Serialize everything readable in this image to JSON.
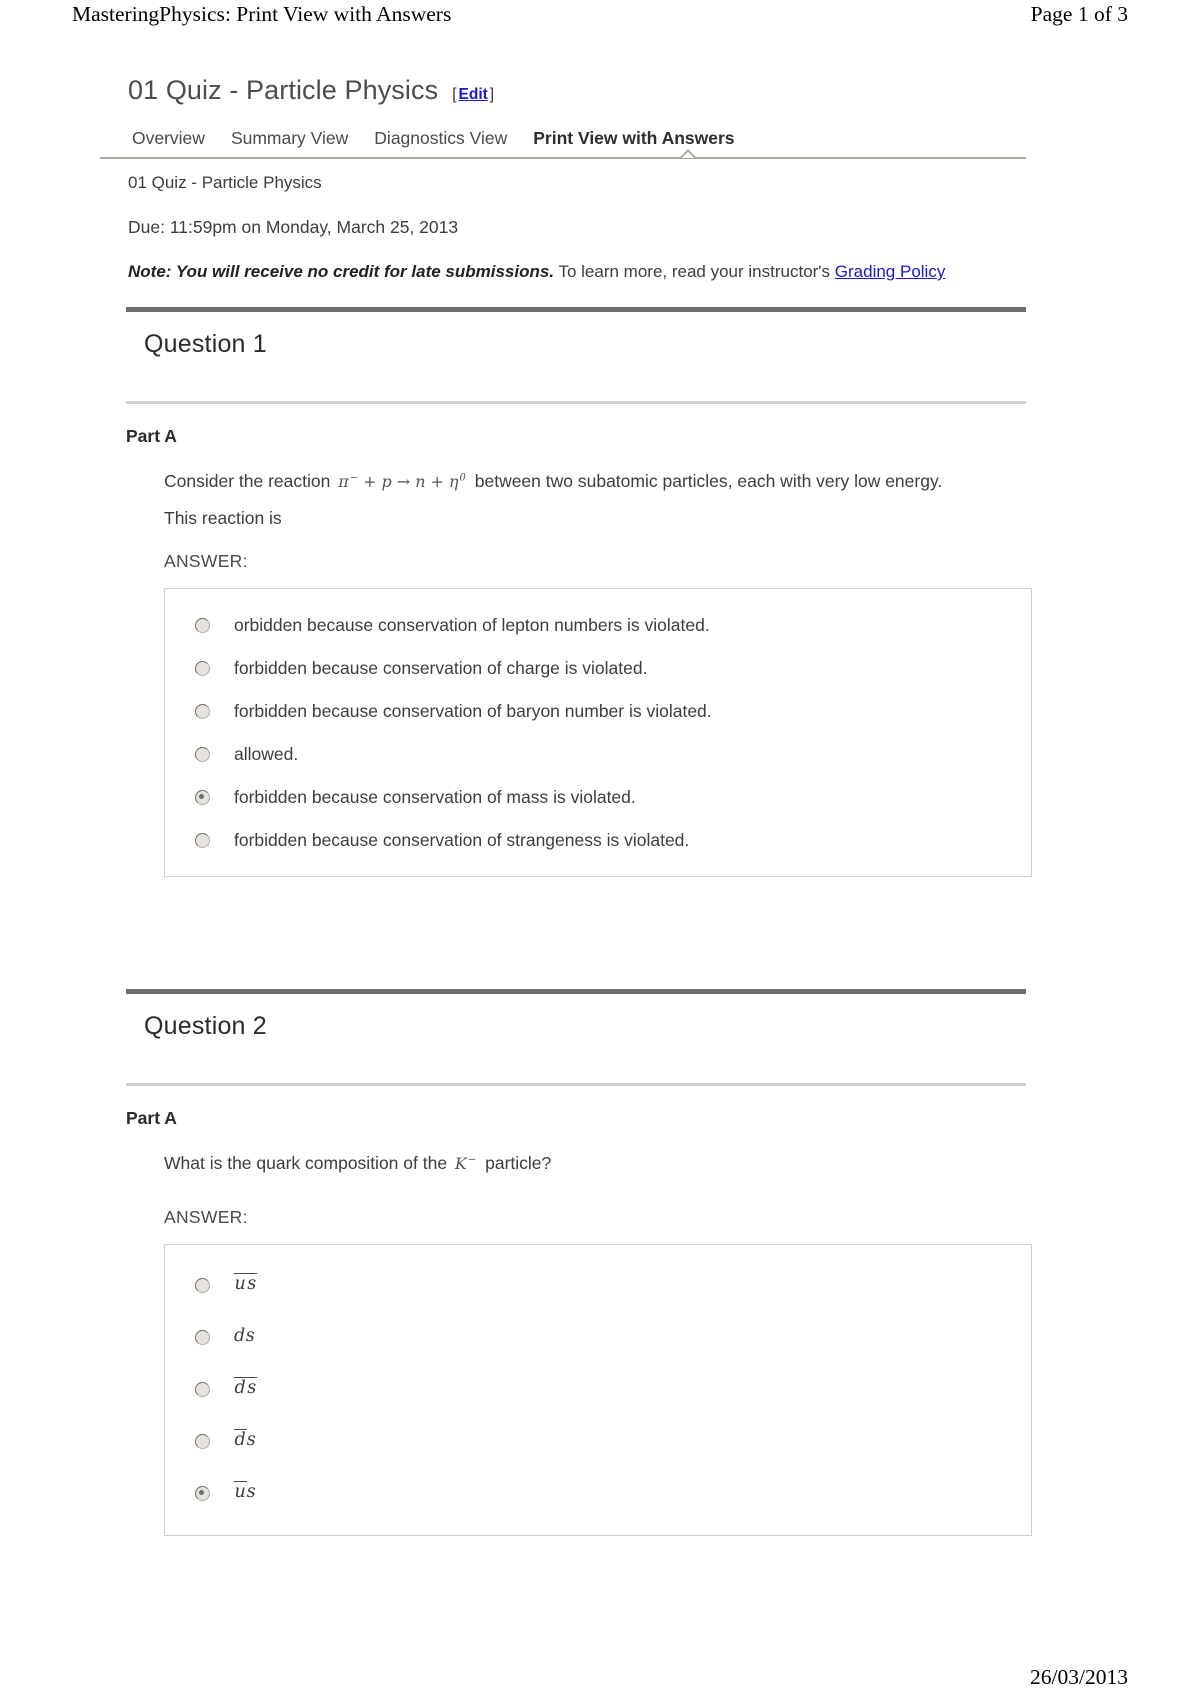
{
  "header": {
    "left_title": "MasteringPhysics: Print View with Answers",
    "page_indicator": "Page 1 of 3"
  },
  "assignment": {
    "title": "01 Quiz - Particle Physics",
    "edit_bracket_open": "[",
    "edit_label": "Edit",
    "edit_bracket_close": "]",
    "subtitle": "01 Quiz - Particle Physics",
    "due_line": "Due: 11:59pm on Monday, March 25, 2013",
    "note_strong": "Note: You will receive no credit for late submissions.",
    "note_rest": " To learn more, read your instructor's ",
    "note_link": "Grading Policy"
  },
  "tabs": [
    {
      "label": "Overview",
      "active": false
    },
    {
      "label": "Summary View",
      "active": false
    },
    {
      "label": "Diagnostics View",
      "active": false
    },
    {
      "label": "Print View with Answers",
      "active": true
    }
  ],
  "questions": [
    {
      "title": "Question 1",
      "part_label": "Part A",
      "prompt_prefix": "Consider the reaction ",
      "equation": {
        "term1": "π",
        "term1_sup": "−",
        "op1": "+",
        "term2": "p",
        "arrow": "→",
        "op2": "+",
        "term3": "n",
        "term4": "η",
        "term4_sup": "0"
      },
      "prompt_suffix": " between two subatomic particles, each with very low energy.",
      "prompt_line2": "This reaction is",
      "answer_label": "ANSWER:",
      "choices": [
        {
          "text": "orbidden because conservation of lepton numbers is violated.",
          "selected": false
        },
        {
          "text": "forbidden because conservation of charge is violated.",
          "selected": false
        },
        {
          "text": "forbidden because conservation of baryon number is violated.",
          "selected": false
        },
        {
          "text": "allowed.",
          "selected": false
        },
        {
          "text": "forbidden because conservation of mass is violated.",
          "selected": true
        },
        {
          "text": "forbidden because conservation of strangeness is violated.",
          "selected": false
        }
      ]
    },
    {
      "title": "Question 2",
      "part_label": "Part A",
      "prompt_prefix": "What is the quark composition of the ",
      "particle": {
        "symbol": "K",
        "sup": "−"
      },
      "prompt_suffix": " particle?",
      "answer_label": "ANSWER:",
      "choices": [
        {
          "quarks": [
            {
              "letter": "u",
              "bar": true
            },
            {
              "letter": "s",
              "bar": true
            }
          ],
          "selected": false
        },
        {
          "quarks": [
            {
              "letter": "d",
              "bar": false
            },
            {
              "letter": "s",
              "bar": false
            }
          ],
          "selected": false
        },
        {
          "quarks": [
            {
              "letter": "d",
              "bar": true
            },
            {
              "letter": "s",
              "bar": true
            }
          ],
          "selected": false
        },
        {
          "quarks": [
            {
              "letter": "d",
              "bar": true
            },
            {
              "letter": "s",
              "bar": false
            }
          ],
          "selected": false
        },
        {
          "quarks": [
            {
              "letter": "u",
              "bar": true
            },
            {
              "letter": "s",
              "bar": false
            }
          ],
          "selected": true
        }
      ]
    }
  ],
  "footer": {
    "date": "26/03/2013"
  },
  "colors": {
    "link": "#1a1ad6",
    "rule_dark": "#6e6e6e",
    "rule_light": "#d2d2d2",
    "tab_rule": "#a9a9a0"
  }
}
